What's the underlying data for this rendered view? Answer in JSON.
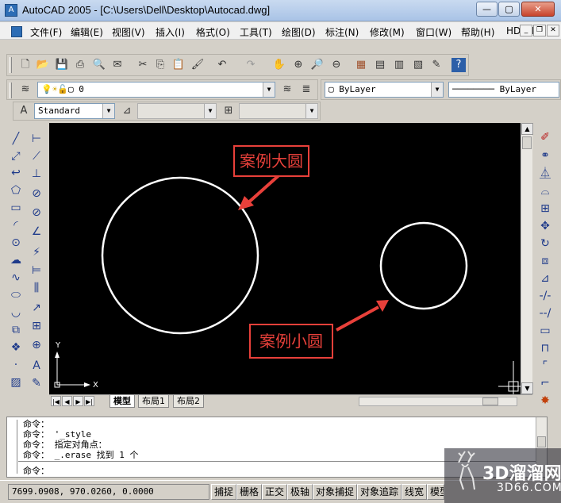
{
  "app": {
    "title": "AutoCAD 2005 - [C:\\Users\\Dell\\Desktop\\Autocad.dwg]",
    "icon_letter": "A"
  },
  "menu": [
    "文件(F)",
    "编辑(E)",
    "视图(V)",
    "插入(I)",
    "格式(O)",
    "工具(T)",
    "绘图(D)",
    "标注(N)",
    "修改(M)",
    "窗口(W)",
    "帮助(H)",
    "HDSHM"
  ],
  "layer": {
    "name": "0",
    "color_value": "ByLayer",
    "linetype_value": "ByLayer"
  },
  "style": {
    "text_style": "Standard"
  },
  "annotations": {
    "big": "案例大圆",
    "small": "案例小圆"
  },
  "ucs": {
    "x_label": "X",
    "y_label": "Y"
  },
  "tabs": {
    "model": "模型",
    "layout1": "布局1",
    "layout2": "布局2"
  },
  "command": {
    "lines": [
      "命令：",
      "命令： '_style",
      "命令： 指定对角点：",
      "命令： _.erase 找到 1 个"
    ],
    "prompt": "命令："
  },
  "status": {
    "coords": "7699.0908, 970.0260, 0.0000",
    "buttons": [
      "捕捉",
      "栅格",
      "正交",
      "极轴",
      "对象捕捉",
      "对象追踪",
      "线宽",
      "模型"
    ]
  },
  "watermark": {
    "text": "3D溜溜网",
    "url": "3D66.COM"
  },
  "colors": {
    "annotation_red": "#e8403a",
    "canvas": "#000000",
    "circle": "#ffffff"
  }
}
